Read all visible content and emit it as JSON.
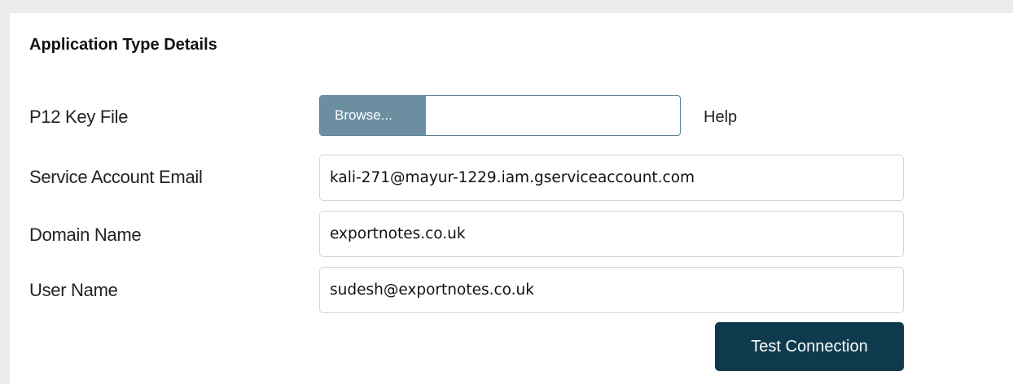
{
  "section": {
    "title": "Application Type Details"
  },
  "fields": {
    "p12_key_file": {
      "label": "P12 Key File",
      "browse_label": "Browse...",
      "file_value": "",
      "help_label": "Help"
    },
    "service_account_email": {
      "label": "Service Account Email",
      "value": "kali-271@mayur-1229.iam.gserviceaccount.com"
    },
    "domain_name": {
      "label": "Domain Name",
      "value": "exportnotes.co.uk"
    },
    "user_name": {
      "label": "User Name",
      "value": "sudesh@exportnotes.co.uk"
    }
  },
  "actions": {
    "test_connection_label": "Test Connection"
  },
  "colors": {
    "browse_bg": "#6b8fa1",
    "primary_button_bg": "#0f3a4d",
    "outer_bg": "#ececec"
  }
}
